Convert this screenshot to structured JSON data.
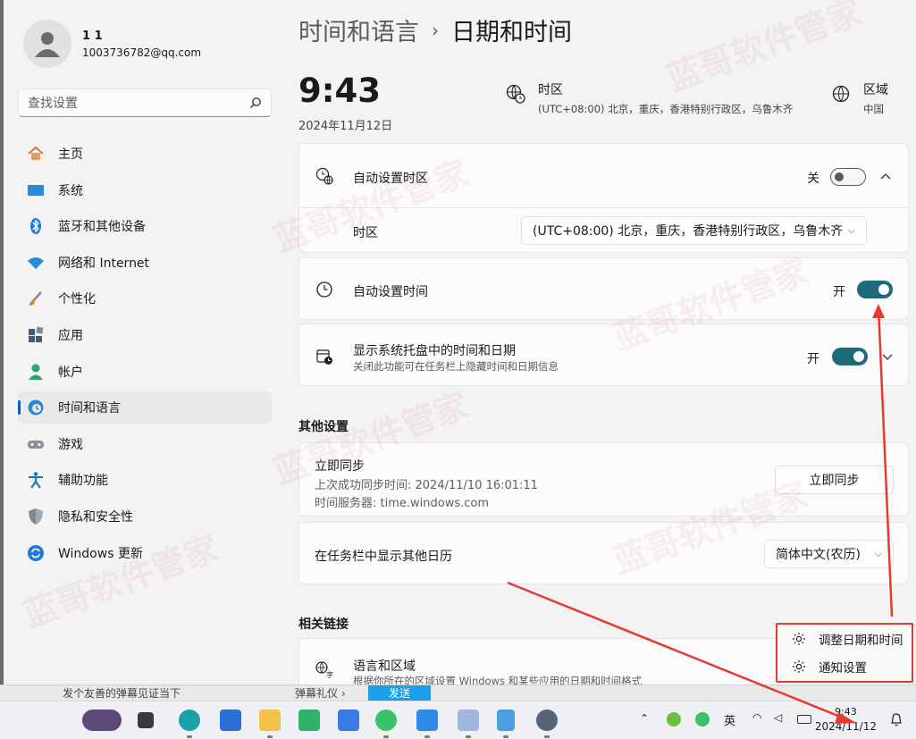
{
  "user": {
    "name": "1 1",
    "email": "1003736782@qq.com"
  },
  "search": {
    "placeholder": "查找设置"
  },
  "nav": [
    {
      "label": "主页"
    },
    {
      "label": "系统"
    },
    {
      "label": "蓝牙和其他设备"
    },
    {
      "label": "网络和 Internet"
    },
    {
      "label": "个性化"
    },
    {
      "label": "应用"
    },
    {
      "label": "帐户"
    },
    {
      "label": "时间和语言"
    },
    {
      "label": "游戏"
    },
    {
      "label": "辅助功能"
    },
    {
      "label": "隐私和安全性"
    },
    {
      "label": "Windows 更新"
    }
  ],
  "breadcrumb": {
    "parent": "时间和语言",
    "separator": "›",
    "current": "日期和时间"
  },
  "clock": {
    "time": "9:43",
    "date": "2024年11月12日"
  },
  "timezone_info": {
    "title": "时区",
    "value": "(UTC+08:00) 北京，重庆，香港特别行政区，乌鲁木齐"
  },
  "region_info": {
    "title": "区域",
    "value": "中国"
  },
  "auto_timezone": {
    "label": "自动设置时区",
    "state": "关"
  },
  "timezone_row": {
    "label": "时区",
    "selected": "(UTC+08:00) 北京，重庆，香港特别行政区，乌鲁木齐"
  },
  "auto_time": {
    "label": "自动设置时间",
    "state": "开"
  },
  "show_tray": {
    "label": "显示系统托盘中的时间和日期",
    "sub": "关闭此功能可在任务栏上隐藏时间和日期信息",
    "state": "开"
  },
  "other_settings": {
    "title": "其他设置",
    "sync": {
      "label": "立即同步",
      "last": "上次成功同步时间: 2024/11/10 16:01:11",
      "server": "时间服务器: time.windows.com",
      "button": "立即同步"
    },
    "calendar": {
      "label": "在任务栏中显示其他日历",
      "selected": "简体中文(农历)"
    }
  },
  "related": {
    "title": "相关链接",
    "lang_region": {
      "label": "语言和区域",
      "sub": "根据你所在的区域设置 Windows 和某些应用的日期和时间格式"
    }
  },
  "context_menu": {
    "items": [
      "调整日期和时间",
      "通知设置"
    ]
  },
  "chat_strip": {
    "text1": "发个友善的弹幕见证当下",
    "text2": "弹幕礼仪 ›",
    "send": "发送"
  },
  "tray": {
    "ime": "英",
    "time": "9:43",
    "date": "2024/11/12"
  },
  "watermark": "蓝哥软件管家",
  "colors": {
    "accent": "#005fb8",
    "toggle_on": "#1d6b78",
    "annotation": "#e53b2c"
  }
}
